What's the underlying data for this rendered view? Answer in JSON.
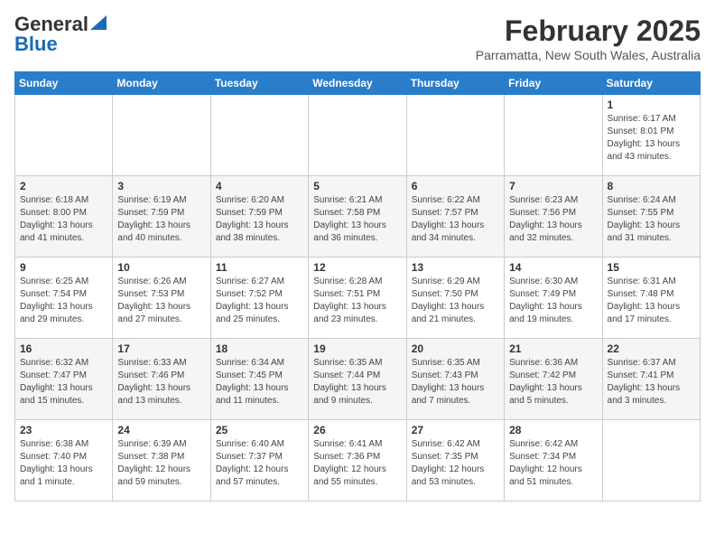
{
  "header": {
    "logo_general": "General",
    "logo_blue": "Blue",
    "month_title": "February 2025",
    "location": "Parramatta, New South Wales, Australia"
  },
  "weekdays": [
    "Sunday",
    "Monday",
    "Tuesday",
    "Wednesday",
    "Thursday",
    "Friday",
    "Saturday"
  ],
  "weeks": [
    [
      {
        "day": "",
        "info": ""
      },
      {
        "day": "",
        "info": ""
      },
      {
        "day": "",
        "info": ""
      },
      {
        "day": "",
        "info": ""
      },
      {
        "day": "",
        "info": ""
      },
      {
        "day": "",
        "info": ""
      },
      {
        "day": "1",
        "info": "Sunrise: 6:17 AM\nSunset: 8:01 PM\nDaylight: 13 hours and 43 minutes."
      }
    ],
    [
      {
        "day": "2",
        "info": "Sunrise: 6:18 AM\nSunset: 8:00 PM\nDaylight: 13 hours and 41 minutes."
      },
      {
        "day": "3",
        "info": "Sunrise: 6:19 AM\nSunset: 7:59 PM\nDaylight: 13 hours and 40 minutes."
      },
      {
        "day": "4",
        "info": "Sunrise: 6:20 AM\nSunset: 7:59 PM\nDaylight: 13 hours and 38 minutes."
      },
      {
        "day": "5",
        "info": "Sunrise: 6:21 AM\nSunset: 7:58 PM\nDaylight: 13 hours and 36 minutes."
      },
      {
        "day": "6",
        "info": "Sunrise: 6:22 AM\nSunset: 7:57 PM\nDaylight: 13 hours and 34 minutes."
      },
      {
        "day": "7",
        "info": "Sunrise: 6:23 AM\nSunset: 7:56 PM\nDaylight: 13 hours and 32 minutes."
      },
      {
        "day": "8",
        "info": "Sunrise: 6:24 AM\nSunset: 7:55 PM\nDaylight: 13 hours and 31 minutes."
      }
    ],
    [
      {
        "day": "9",
        "info": "Sunrise: 6:25 AM\nSunset: 7:54 PM\nDaylight: 13 hours and 29 minutes."
      },
      {
        "day": "10",
        "info": "Sunrise: 6:26 AM\nSunset: 7:53 PM\nDaylight: 13 hours and 27 minutes."
      },
      {
        "day": "11",
        "info": "Sunrise: 6:27 AM\nSunset: 7:52 PM\nDaylight: 13 hours and 25 minutes."
      },
      {
        "day": "12",
        "info": "Sunrise: 6:28 AM\nSunset: 7:51 PM\nDaylight: 13 hours and 23 minutes."
      },
      {
        "day": "13",
        "info": "Sunrise: 6:29 AM\nSunset: 7:50 PM\nDaylight: 13 hours and 21 minutes."
      },
      {
        "day": "14",
        "info": "Sunrise: 6:30 AM\nSunset: 7:49 PM\nDaylight: 13 hours and 19 minutes."
      },
      {
        "day": "15",
        "info": "Sunrise: 6:31 AM\nSunset: 7:48 PM\nDaylight: 13 hours and 17 minutes."
      }
    ],
    [
      {
        "day": "16",
        "info": "Sunrise: 6:32 AM\nSunset: 7:47 PM\nDaylight: 13 hours and 15 minutes."
      },
      {
        "day": "17",
        "info": "Sunrise: 6:33 AM\nSunset: 7:46 PM\nDaylight: 13 hours and 13 minutes."
      },
      {
        "day": "18",
        "info": "Sunrise: 6:34 AM\nSunset: 7:45 PM\nDaylight: 13 hours and 11 minutes."
      },
      {
        "day": "19",
        "info": "Sunrise: 6:35 AM\nSunset: 7:44 PM\nDaylight: 13 hours and 9 minutes."
      },
      {
        "day": "20",
        "info": "Sunrise: 6:35 AM\nSunset: 7:43 PM\nDaylight: 13 hours and 7 minutes."
      },
      {
        "day": "21",
        "info": "Sunrise: 6:36 AM\nSunset: 7:42 PM\nDaylight: 13 hours and 5 minutes."
      },
      {
        "day": "22",
        "info": "Sunrise: 6:37 AM\nSunset: 7:41 PM\nDaylight: 13 hours and 3 minutes."
      }
    ],
    [
      {
        "day": "23",
        "info": "Sunrise: 6:38 AM\nSunset: 7:40 PM\nDaylight: 13 hours and 1 minute."
      },
      {
        "day": "24",
        "info": "Sunrise: 6:39 AM\nSunset: 7:38 PM\nDaylight: 12 hours and 59 minutes."
      },
      {
        "day": "25",
        "info": "Sunrise: 6:40 AM\nSunset: 7:37 PM\nDaylight: 12 hours and 57 minutes."
      },
      {
        "day": "26",
        "info": "Sunrise: 6:41 AM\nSunset: 7:36 PM\nDaylight: 12 hours and 55 minutes."
      },
      {
        "day": "27",
        "info": "Sunrise: 6:42 AM\nSunset: 7:35 PM\nDaylight: 12 hours and 53 minutes."
      },
      {
        "day": "28",
        "info": "Sunrise: 6:42 AM\nSunset: 7:34 PM\nDaylight: 12 hours and 51 minutes."
      },
      {
        "day": "",
        "info": ""
      }
    ]
  ]
}
